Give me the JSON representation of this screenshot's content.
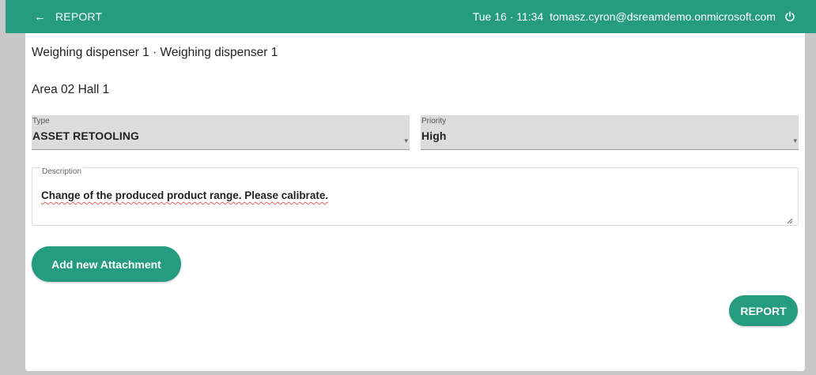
{
  "header": {
    "back_icon": "arrow-left-icon",
    "title": "REPORT",
    "datetime": "Tue 16 · 11:34",
    "user_email": "tomasz.cyron@dsreamdemo.onmicrosoft.com",
    "power_icon": "power-icon"
  },
  "asset": {
    "title": "Weighing dispenser 1 · Weighing dispenser 1",
    "location": "Area 02 Hall 1"
  },
  "form": {
    "type": {
      "label": "Type",
      "value": "ASSET RETOOLING"
    },
    "priority": {
      "label": "Priority",
      "value": "High"
    },
    "description": {
      "label": "Description",
      "value": "Change of the produced product range. Please calibrate."
    }
  },
  "actions": {
    "add_attachment_label": "Add new Attachment",
    "report_label": "REPORT"
  },
  "colors": {
    "accent": "#259b7f",
    "background": "#c8c8c8",
    "field_background": "#dcdcdc"
  }
}
